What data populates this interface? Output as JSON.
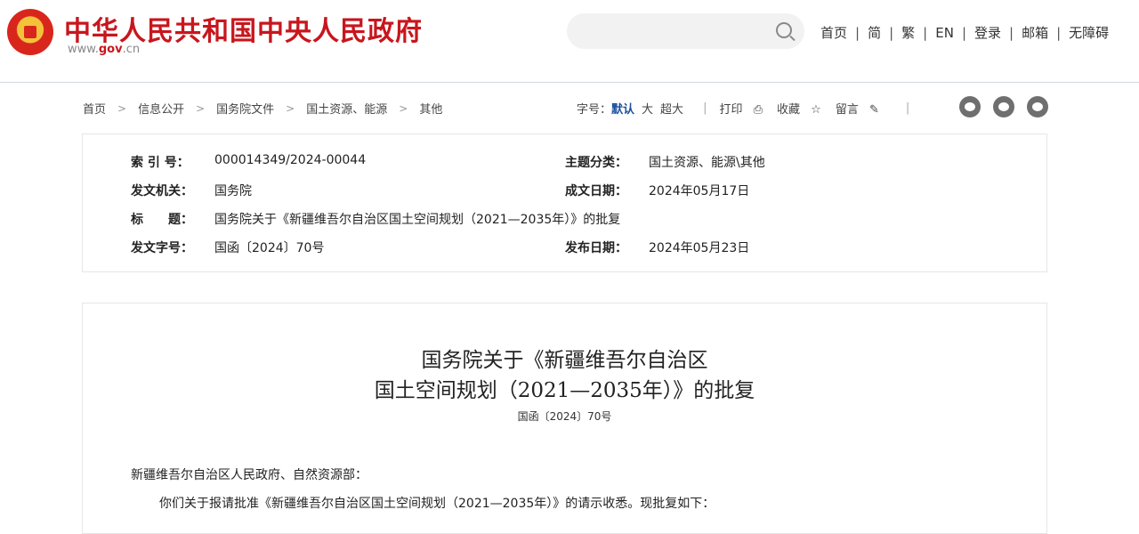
{
  "header": {
    "title": "中华人民共和国中央人民政府",
    "url_prefix": "www.",
    "url_brand": "gov",
    "url_suffix": ".cn",
    "search_placeholder": "",
    "nav": [
      "首页",
      "简",
      "繁",
      "EN",
      "登录",
      "邮箱",
      "无障碍"
    ]
  },
  "breadcrumb": [
    "首页",
    "信息公开",
    "国务院文件",
    "国土资源、能源",
    "其他"
  ],
  "tools": {
    "font_label": "字号：",
    "font_default": "默认",
    "font_large": "大",
    "font_xlarge": "超大",
    "print": "打印",
    "favorite": "收藏",
    "comment": "留言"
  },
  "social_icons": [
    "weibo-icon",
    "wechat-icon",
    "favorite-star-icon"
  ],
  "meta": {
    "index_label": "索 引 号：",
    "index_value": "000014349/2024-00044",
    "topic_label": "主题分类：",
    "topic_value": "国土资源、能源\\其他",
    "issuer_label": "发文机关：",
    "issuer_value": "国务院",
    "date_written_label": "成文日期：",
    "date_written_value": "2024年05月17日",
    "title_label": "标　　题：",
    "title_value": "国务院关于《新疆维吾尔自治区国土空间规划（2021—2035年）》的批复",
    "doc_no_label": "发文字号：",
    "doc_no_value": "国函〔2024〕70号",
    "pub_date_label": "发布日期：",
    "pub_date_value": "2024年05月23日"
  },
  "article": {
    "title_line1": "国务院关于《新疆维吾尔自治区",
    "title_line2": "国土空间规划（2021—2035年）》的批复",
    "doc_no": "国函〔2024〕70号",
    "salutation": "新疆维吾尔自治区人民政府、自然资源部：",
    "para1": "你们关于报请批准《新疆维吾尔自治区国土空间规划（2021—2035年）》的请示收悉。现批复如下："
  },
  "colors": {
    "brand_red": "#c8161d",
    "accent_blue": "#1a4f9c"
  }
}
